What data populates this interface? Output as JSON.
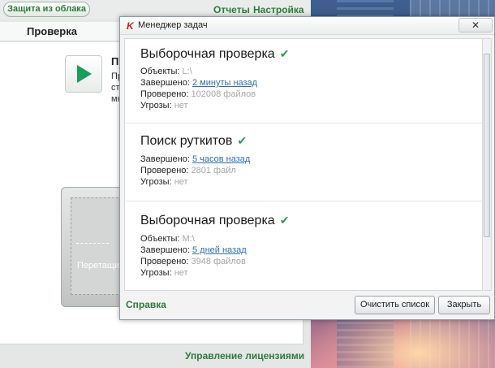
{
  "main_window": {
    "cloud_button": "Защита из облака",
    "links": {
      "reports": "Отчеты",
      "settings": "Настройка"
    },
    "section_title": "Проверка",
    "scan_block": {
      "title": "Пр",
      "lines": [
        "Пр",
        "ст",
        "мн"
      ]
    },
    "drop_text": "Перетащите",
    "license_link": "Управление лицензиями"
  },
  "task_manager": {
    "title": "Менеджер задач",
    "close_glyph": "✕",
    "tasks": [
      {
        "title": "Выборочная проверка",
        "rows": [
          {
            "label": "Объекты:",
            "value": "L:\\"
          },
          {
            "label": "Завершено:",
            "value": "2 минуты назад"
          },
          {
            "label": "Проверено:",
            "value": "102008 файлов"
          },
          {
            "label": "Угрозы:",
            "value": "нет"
          }
        ]
      },
      {
        "title": "Поиск руткитов",
        "rows": [
          {
            "label": "Завершено:",
            "value": "5 часов назад"
          },
          {
            "label": "Проверено:",
            "value": "2801 файл"
          },
          {
            "label": "Угрозы:",
            "value": "нет"
          }
        ]
      },
      {
        "title": "Выборочная проверка",
        "rows": [
          {
            "label": "Объекты:",
            "value": "M:\\"
          },
          {
            "label": "Завершено:",
            "value": "5 дней назад"
          },
          {
            "label": "Проверено:",
            "value": "3948 файлов"
          },
          {
            "label": "Угрозы:",
            "value": "нет"
          }
        ]
      }
    ],
    "help_link": "Справка",
    "clear_button": "Очистить список",
    "close_button": "Закрыть"
  },
  "colors": {
    "accent_green": "#2f7a3e",
    "check_green": "#2d9b4e",
    "link_blue": "#2f6fb5",
    "kaspersky_red": "#d11f1f"
  },
  "icons": [
    "play-icon",
    "check-icon",
    "kaspersky-logo-icon",
    "close-icon"
  ]
}
